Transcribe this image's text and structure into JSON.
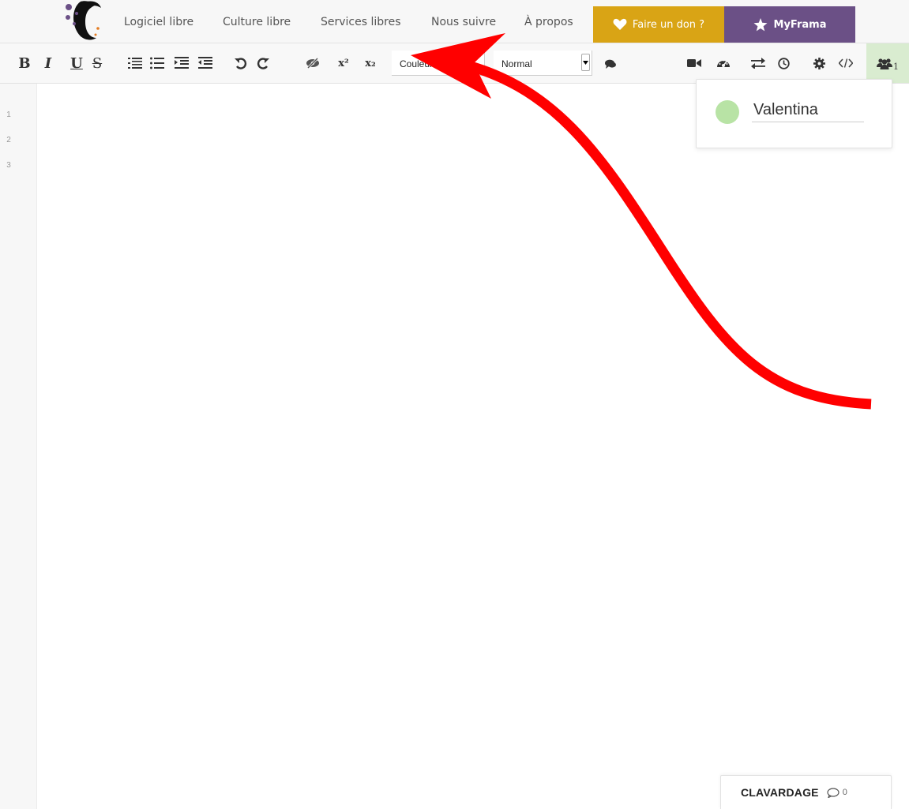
{
  "nav": {
    "links": [
      "Logiciel libre",
      "Culture libre",
      "Services libres",
      "Nous suivre",
      "À propos"
    ],
    "donate_label": "Faire un don ?",
    "myframa_label": "MyFrama"
  },
  "toolbar": {
    "bold": "B",
    "italic": "I",
    "underline": "U",
    "strike": "S",
    "superscript": "x²",
    "subscript": "x₂",
    "color_select": "Couleur",
    "style_select": "Normal",
    "user_count": "1"
  },
  "gutter": {
    "line_numbers": [
      "1",
      "2",
      "3"
    ]
  },
  "users_popup": {
    "user_name": "Valentina",
    "user_color": "#b8e3a5"
  },
  "chat": {
    "label": "CLAVARDAGE",
    "count": "0"
  },
  "colors": {
    "donate": "#d9a415",
    "myframa": "#6b5086",
    "annotation_arrow": "#ff0000",
    "users_button": "#d9ecd0"
  }
}
